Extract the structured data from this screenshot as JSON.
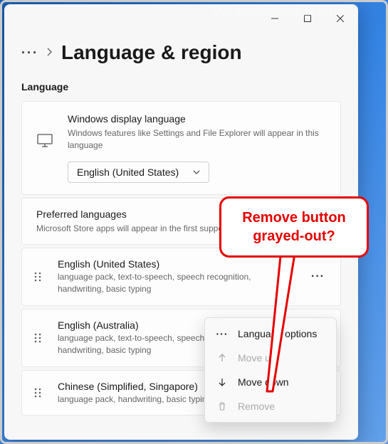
{
  "watermark": "WindowsDigital.com",
  "breadcrumb": {
    "page_title": "Language & region"
  },
  "section_label": "Language",
  "display_language": {
    "title": "Windows display language",
    "desc": "Windows features like Settings and File Explorer will appear in this language",
    "selected": "English (United States)"
  },
  "preferred": {
    "title": "Preferred languages",
    "desc": "Microsoft Store apps will appear in the first supported language in this list"
  },
  "languages": [
    {
      "name": "English (United States)",
      "features": "language pack, text-to-speech, speech recognition, handwriting, basic typing"
    },
    {
      "name": "English (Australia)",
      "features": "language pack, text-to-speech, speech recognition, handwriting, basic typing"
    },
    {
      "name": "Chinese (Simplified, Singapore)",
      "features": "language pack, handwriting, basic typing"
    }
  ],
  "menu": {
    "options": "Language options",
    "move_up": "Move up",
    "move_down": "Move down",
    "remove": "Remove"
  },
  "callout": {
    "line1": "Remove button",
    "line2": "grayed-out?"
  }
}
